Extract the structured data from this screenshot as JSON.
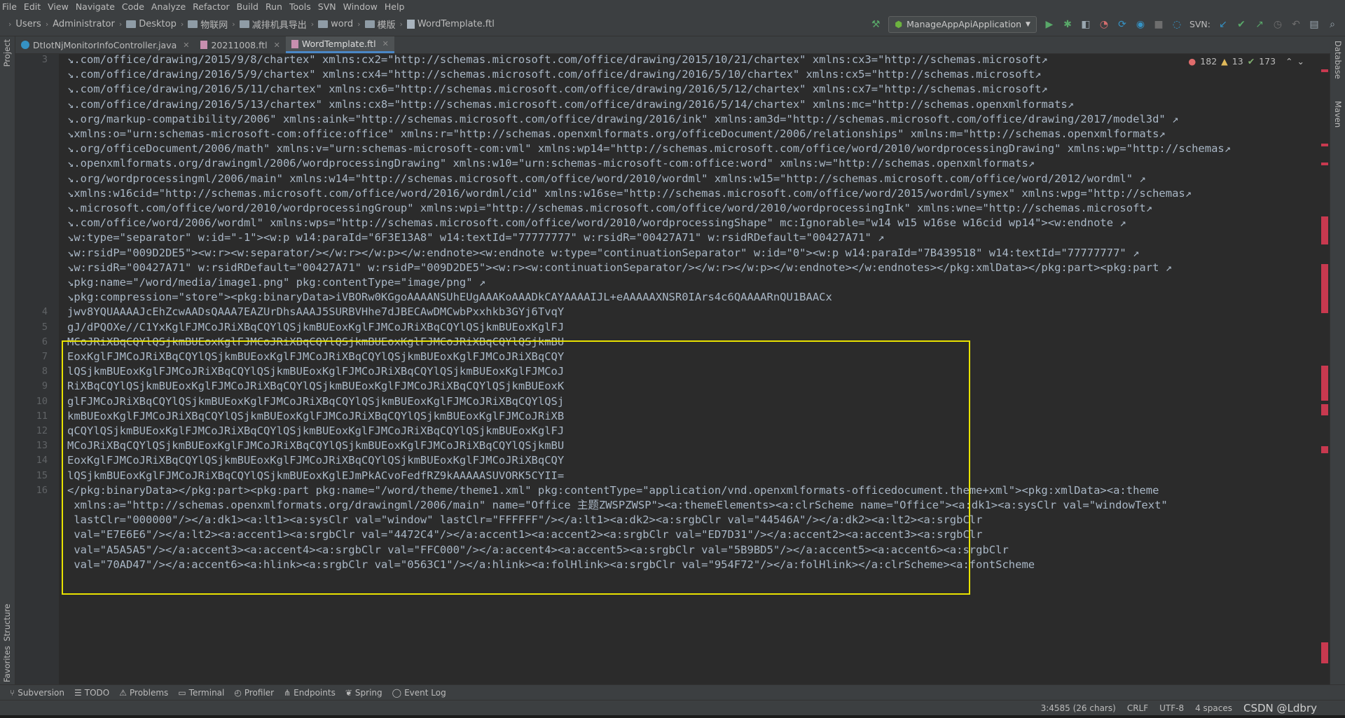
{
  "menu": [
    "File",
    "Edit",
    "View",
    "Navigate",
    "Code",
    "Analyze",
    "Refactor",
    "Build",
    "Run",
    "Tools",
    "SVN",
    "Window",
    "Help"
  ],
  "breadcrumb": [
    "Users",
    "Administrator",
    "Desktop",
    "物联网",
    "减排机具导出",
    "word",
    "模版",
    "WordTemplate.ftl"
  ],
  "run_config": "ManageAppApiApplication",
  "svn_label": "SVN:",
  "tabs": [
    {
      "label": "DtIotNjMonitorInfoController.java",
      "icon": "java-class-icon",
      "active": false
    },
    {
      "label": "20211008.ftl",
      "icon": "ftl-file-icon",
      "active": false
    },
    {
      "label": "WordTemplate.ftl",
      "icon": "ftl-file-icon",
      "active": true
    }
  ],
  "side_left": [
    "Project",
    "Structure",
    "Favorites"
  ],
  "side_right": [
    "Database",
    "Maven"
  ],
  "inspections": {
    "errors": "182",
    "warnings": "13",
    "ok": "173"
  },
  "line_numbers": [
    "3",
    "4",
    "5",
    "6",
    "7",
    "8",
    "9",
    "10",
    "11",
    "12",
    "13",
    "14",
    "15",
    "16"
  ],
  "code_lines": [
    "↘.com/office/drawing/2015/9/8/chartex\" xmlns:cx2=\"http://schemas.microsoft.com/office/drawing/2015/10/21/chartex\" xmlns:cx3=\"http://schemas.microsoft↗",
    "↘.com/office/drawing/2016/5/9/chartex\" xmlns:cx4=\"http://schemas.microsoft.com/office/drawing/2016/5/10/chartex\" xmlns:cx5=\"http://schemas.microsoft↗",
    "↘.com/office/drawing/2016/5/11/chartex\" xmlns:cx6=\"http://schemas.microsoft.com/office/drawing/2016/5/12/chartex\" xmlns:cx7=\"http://schemas.microsoft↗",
    "↘.com/office/drawing/2016/5/13/chartex\" xmlns:cx8=\"http://schemas.microsoft.com/office/drawing/2016/5/14/chartex\" xmlns:mc=\"http://schemas.openxmlformats↗",
    "↘.org/markup-compatibility/2006\" xmlns:aink=\"http://schemas.microsoft.com/office/drawing/2016/ink\" xmlns:am3d=\"http://schemas.microsoft.com/office/drawing/2017/model3d\" ↗",
    "↘xmlns:o=\"urn:schemas-microsoft-com:office:office\" xmlns:r=\"http://schemas.openxmlformats.org/officeDocument/2006/relationships\" xmlns:m=\"http://schemas.openxmlformats↗",
    "↘.org/officeDocument/2006/math\" xmlns:v=\"urn:schemas-microsoft-com:vml\" xmlns:wp14=\"http://schemas.microsoft.com/office/word/2010/wordprocessingDrawing\" xmlns:wp=\"http://schemas↗",
    "↘.openxmlformats.org/drawingml/2006/wordprocessingDrawing\" xmlns:w10=\"urn:schemas-microsoft-com:office:word\" xmlns:w=\"http://schemas.openxmlformats↗",
    "↘.org/wordprocessingml/2006/main\" xmlns:w14=\"http://schemas.microsoft.com/office/word/2010/wordml\" xmlns:w15=\"http://schemas.microsoft.com/office/word/2012/wordml\" ↗",
    "↘xmlns:w16cid=\"http://schemas.microsoft.com/office/word/2016/wordml/cid\" xmlns:w16se=\"http://schemas.microsoft.com/office/word/2015/wordml/symex\" xmlns:wpg=\"http://schemas↗",
    "↘.microsoft.com/office/word/2010/wordprocessingGroup\" xmlns:wpi=\"http://schemas.microsoft.com/office/word/2010/wordprocessingInk\" xmlns:wne=\"http://schemas.microsoft↗",
    "↘.com/office/word/2006/wordml\" xmlns:wps=\"http://schemas.microsoft.com/office/word/2010/wordprocessingShape\" mc:Ignorable=\"w14 w15 w16se w16cid wp14\"><w:endnote ↗",
    "↘w:type=\"separator\" w:id=\"-1\"><w:p w14:paraId=\"6F3E13A8\" w14:textId=\"77777777\" w:rsidR=\"00427A71\" w:rsidRDefault=\"00427A71\" ↗",
    "↘w:rsidP=\"009D2DE5\"><w:r><w:separator/></w:r></w:p></w:endnote><w:endnote w:type=\"continuationSeparator\" w:id=\"0\"><w:p w14:paraId=\"7B439518\" w14:textId=\"77777777\" ↗",
    "↘w:rsidR=\"00427A71\" w:rsidRDefault=\"00427A71\" w:rsidP=\"009D2DE5\"><w:r><w:continuationSeparator/></w:r></w:p></w:endnote></w:endnotes></pkg:xmlData></pkg:part><pkg:part ↗",
    "↘pkg:name=\"/word/media/image1.png\" pkg:contentType=\"image/png\" ↗",
    "↘pkg:compression=\"store\"><pkg:binaryData>iVBORw0KGgoAAAANSUhEUgAAAKoAAADkCAYAAAAIJL+eAAAAAXNSR0IArs4c6QAAAARnQU1BAACx",
    "jwv8YQUAAAAJcEhZcwAADsQAAA7EAZUrDhsAAAJ5SURBVHhe7dJBECAwDMCwbPxxhkb3GYj6TvqY",
    "gJ/dPQOXe//C1YxKglFJMCoJRiXBqCQYlQSjkmBUEoxKglFJMCoJRiXBqCQYlQSjkmBUEoxKglFJ",
    "MCoJRiXBqCQYlQSjkmBUEoxKglFJMCoJRiXBqCQYlQSjkmBUEoxKglFJMCoJRiXBqCQYlQSjkmBU",
    "EoxKglFJMCoJRiXBqCQYlQSjkmBUEoxKglFJMCoJRiXBqCQYlQSjkmBUEoxKglFJMCoJRiXBqCQY",
    "lQSjkmBUEoxKglFJMCoJRiXBqCQYlQSjkmBUEoxKglFJMCoJRiXBqCQYlQSjkmBUEoxKglFJMCoJ",
    "RiXBqCQYlQSjkmBUEoxKglFJMCoJRiXBqCQYlQSjkmBUEoxKglFJMCoJRiXBqCQYlQSjkmBUEoxK",
    "glFJMCoJRiXBqCQYlQSjkmBUEoxKglFJMCoJRiXBqCQYlQSjkmBUEoxKglFJMCoJRiXBqCQYlQSj",
    "kmBUEoxKglFJMCoJRiXBqCQYlQSjkmBUEoxKglFJMCoJRiXBqCQYlQSjkmBUEoxKglFJMCoJRiXB",
    "qCQYlQSjkmBUEoxKglFJMCoJRiXBqCQYlQSjkmBUEoxKglFJMCoJRiXBqCQYlQSjkmBUEoxKglFJ",
    "MCoJRiXBqCQYlQSjkmBUEoxKglFJMCoJRiXBqCQYlQSjkmBUEoxKglFJMCoJRiXBqCQYlQSjkmBU",
    "EoxKglFJMCoJRiXBqCQYlQSjkmBUEoxKglFJMCoJRiXBqCQYlQSjkmBUEoxKglFJMCoJRiXBqCQY",
    "lQSjkmBUEoxKglFJMCoJRiXBqCQYlQSjkmBUEoxKglEJmPkACvoFedfRZ9kAAAAASUVORK5CYII=",
    "</pkg:binaryData></pkg:part><pkg:part pkg:name=\"/word/theme/theme1.xml\" pkg:contentType=\"application/vnd.openxmlformats-officedocument.theme+xml\"><pkg:xmlData><a:theme",
    " xmlns:a=\"http://schemas.openxmlformats.org/drawingml/2006/main\" name=\"Office 主题ZWSPZWSP\"><a:themeElements><a:clrScheme name=\"Office\"><a:dk1><a:sysClr val=\"windowText\"",
    " lastClr=\"000000\"/></a:dk1><a:lt1><a:sysClr val=\"window\" lastClr=\"FFFFFF\"/></a:lt1><a:dk2><a:srgbClr val=\"44546A\"/></a:dk2><a:lt2><a:srgbClr",
    " val=\"E7E6E6\"/></a:lt2><a:accent1><a:srgbClr val=\"4472C4\"/></a:accent1><a:accent2><a:srgbClr val=\"ED7D31\"/></a:accent2><a:accent3><a:srgbClr",
    " val=\"A5A5A5\"/></a:accent3><a:accent4><a:srgbClr val=\"FFC000\"/></a:accent4><a:accent5><a:srgbClr val=\"5B9BD5\"/></a:accent5><a:accent6><a:srgbClr",
    " val=\"70AD47\"/></a:accent6><a:hlink><a:srgbClr val=\"0563C1\"/></a:hlink><a:folHlink><a:srgbClr val=\"954F72\"/></a:folHlink></a:clrScheme><a:fontScheme"
  ],
  "bottom_tools": [
    "Subversion",
    "TODO",
    "Problems",
    "Terminal",
    "Profiler",
    "Endpoints",
    "Spring",
    "Event Log"
  ],
  "status": {
    "position": "3:4585 (26 chars)",
    "line_sep": "CRLF",
    "encoding": "UTF-8",
    "indent": "4 spaces",
    "watermark": "CSDN @Ldbry"
  },
  "colors": {
    "highlight_box": "#e8e200",
    "accent_tab": "#4a88c7",
    "error_mark": "#c8394f"
  }
}
